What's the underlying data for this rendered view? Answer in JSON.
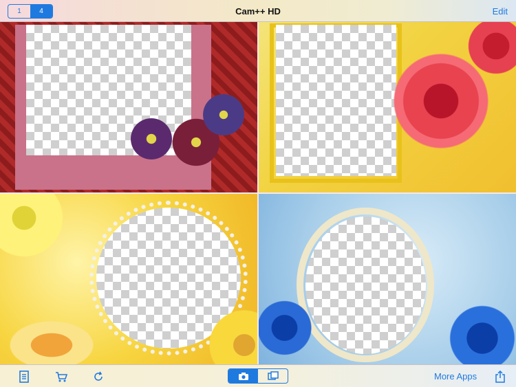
{
  "header": {
    "title": "Cam++ HD",
    "edit_label": "Edit",
    "segment": [
      "1",
      "4"
    ],
    "segment_selected": "4"
  },
  "frames": [
    {
      "name": "red-woven-flower-frame"
    },
    {
      "name": "yellow-rose-frame"
    },
    {
      "name": "daisy-pearl-frame"
    },
    {
      "name": "blue-rose-oval-frame"
    }
  ],
  "toolbar": {
    "more_apps_label": "More Apps",
    "mode_segment": [
      "camera-icon",
      "gallery-icon"
    ],
    "mode_selected": "camera-icon"
  },
  "colors": {
    "accent": "#1f7ae0"
  }
}
